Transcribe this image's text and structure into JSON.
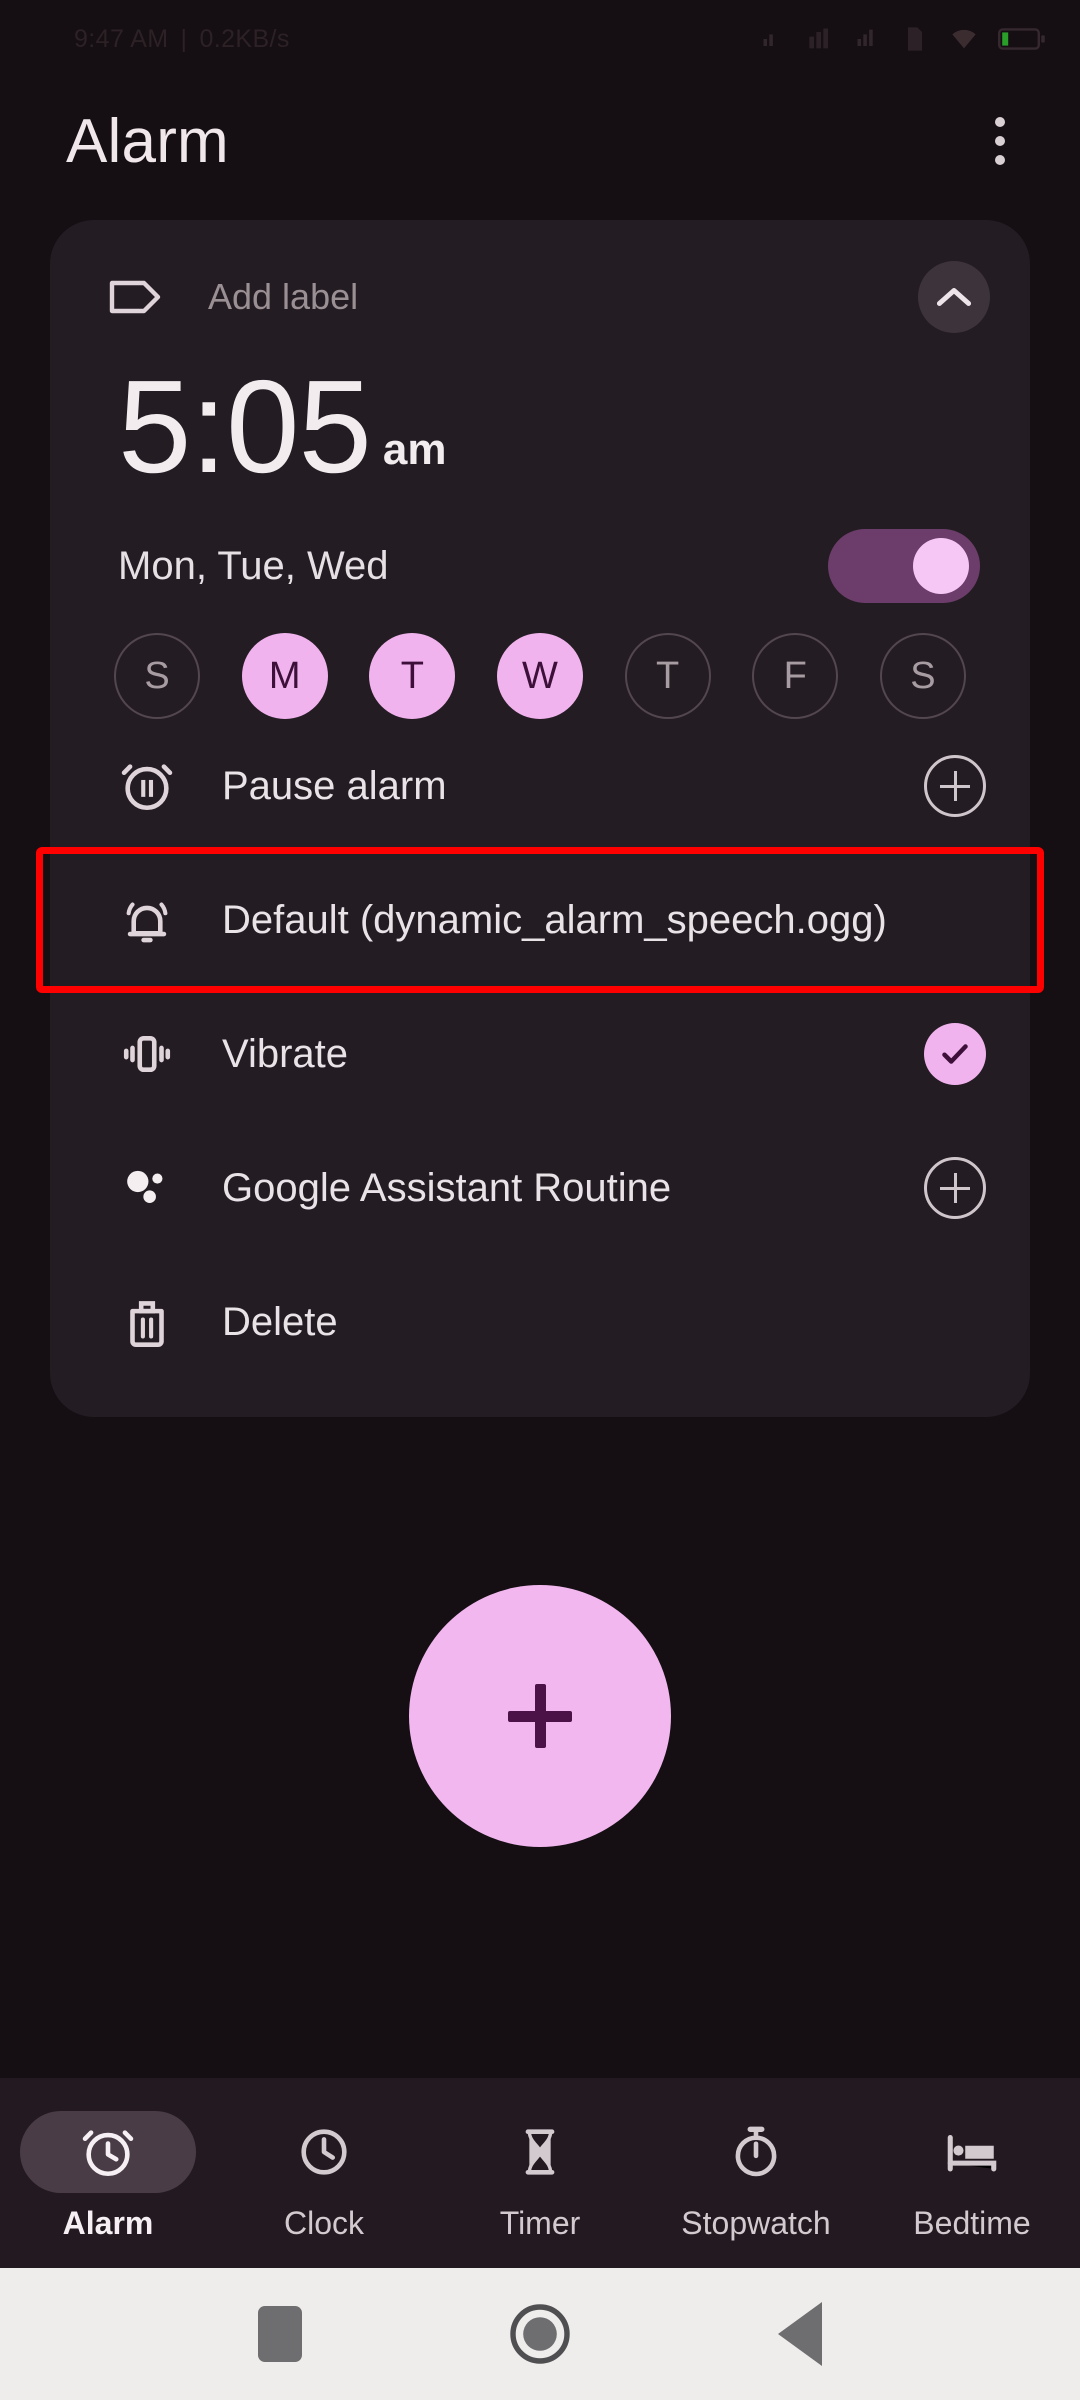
{
  "status_bar": {
    "time": "9:47 AM",
    "separator": "|",
    "network_speed": "0.2KB/s",
    "icons": [
      "signal-icon",
      "mobile-data-icon",
      "signal-2-icon",
      "sim-icon",
      "wifi-icon",
      "battery-icon"
    ],
    "battery_accent": "#2fc72f"
  },
  "app_bar": {
    "title": "Alarm",
    "overflow_label": "More options"
  },
  "alarm_card": {
    "label_placeholder": "Add label",
    "collapse_action": "Collapse",
    "time": "5:05",
    "ampm": "am",
    "days_summary": "Mon, Tue, Wed",
    "enabled": true,
    "day_dots": [
      {
        "letter": "S",
        "selected": false,
        "name": "sunday"
      },
      {
        "letter": "M",
        "selected": true,
        "name": "monday"
      },
      {
        "letter": "T",
        "selected": true,
        "name": "tuesday"
      },
      {
        "letter": "W",
        "selected": true,
        "name": "wednesday"
      },
      {
        "letter": "T",
        "selected": false,
        "name": "thursday"
      },
      {
        "letter": "F",
        "selected": false,
        "name": "friday"
      },
      {
        "letter": "S",
        "selected": false,
        "name": "saturday"
      }
    ],
    "options": {
      "pause_alarm": "Pause alarm",
      "ringtone": "Default (dynamic_alarm_speech.ogg)",
      "vibrate": "Vibrate",
      "assistant_routine": "Google Assistant Routine",
      "delete": "Delete"
    },
    "vibrate_checked": true,
    "highlight_color": "#fe0000"
  },
  "fab": {
    "label": "Add alarm",
    "color": "#f2b7ef"
  },
  "bottom_nav": {
    "items": [
      {
        "label": "Alarm",
        "icon": "alarm-clock-icon",
        "active": true
      },
      {
        "label": "Clock",
        "icon": "clock-icon",
        "active": false
      },
      {
        "label": "Timer",
        "icon": "hourglass-icon",
        "active": false
      },
      {
        "label": "Stopwatch",
        "icon": "stopwatch-icon",
        "active": false
      },
      {
        "label": "Bedtime",
        "icon": "bed-icon",
        "active": false
      }
    ]
  },
  "system_nav": {
    "recents": "Recent apps",
    "home": "Home",
    "back": "Back"
  }
}
